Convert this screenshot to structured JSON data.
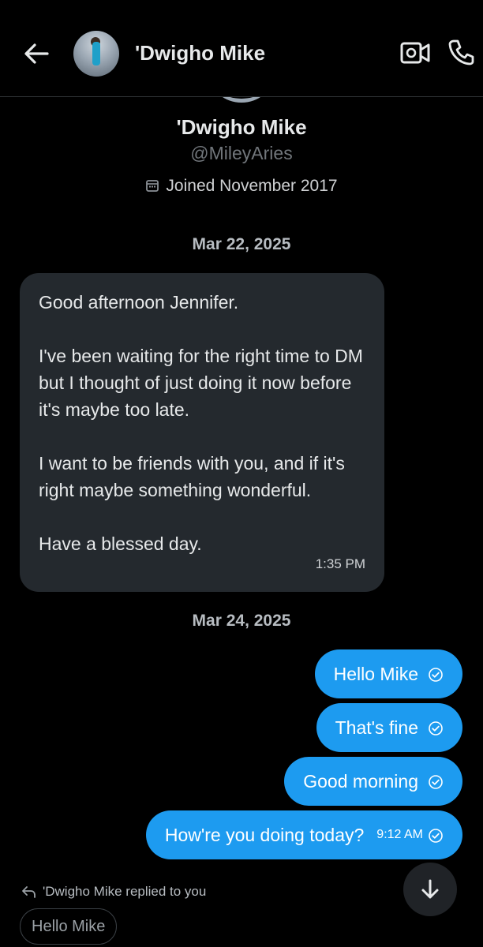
{
  "header": {
    "title": "'Dwigho Mike",
    "back_icon": "arrow-left-icon",
    "video_icon": "video-camera-icon",
    "call_icon": "phone-icon"
  },
  "profile": {
    "name": "'Dwigho Mike",
    "handle": "@MileyAries",
    "joined": "Joined November 2017"
  },
  "dates": [
    "Mar 22, 2025",
    "Mar 24, 2025"
  ],
  "incoming": {
    "paragraphs": [
      "Good afternoon Jennifer.",
      "I've been waiting for the right time to DM but I thought of just doing it now before it's maybe too late.",
      "I want to be friends with you, and if it's right maybe something wonderful.",
      "Have a blessed day."
    ],
    "time": "1:35 PM"
  },
  "outgoing": [
    {
      "text": "Hello Mike"
    },
    {
      "text": "That's fine"
    },
    {
      "text": "Good morning"
    },
    {
      "text": "How're you doing today?",
      "time": "9:12 AM"
    }
  ],
  "reply_notice": "'Dwigho Mike replied to you",
  "reply_chip": "Hello Mike",
  "colors": {
    "accent": "#1d9bf0",
    "incoming_bubble": "#24292e",
    "background": "#000000"
  }
}
